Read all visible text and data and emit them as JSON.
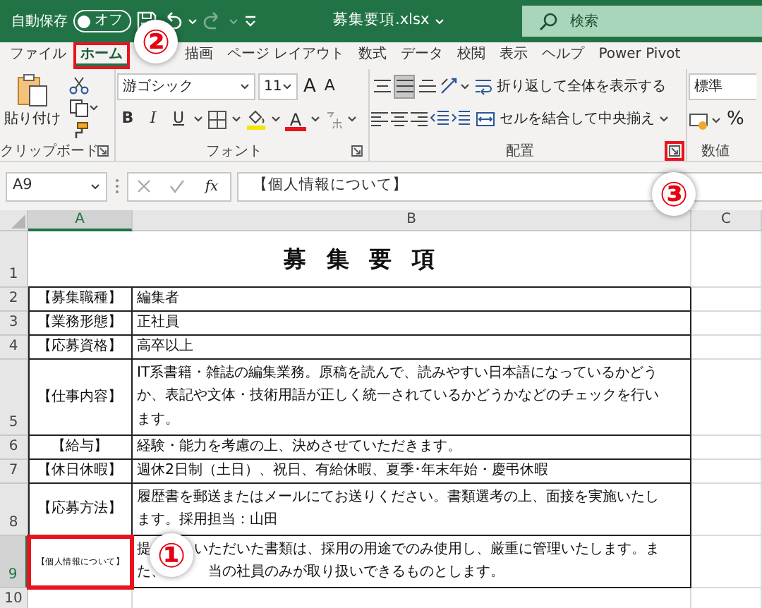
{
  "title_bar": {
    "autosave_label": "自動保存",
    "autosave": {
      "on": false,
      "label": "オフ"
    },
    "file_name": "募集要項.xlsx",
    "search_placeholder": "検索"
  },
  "tabs": [
    {
      "label": "ファイル",
      "selected": false,
      "highlighted": false
    },
    {
      "label": "ホーム",
      "selected": true,
      "highlighted": true
    },
    {
      "label": "描画",
      "selected": false,
      "highlighted": false
    },
    {
      "label": "ページ レイアウト",
      "selected": false,
      "highlighted": false
    },
    {
      "label": "数式",
      "selected": false,
      "highlighted": false
    },
    {
      "label": "データ",
      "selected": false,
      "highlighted": false
    },
    {
      "label": "校閲",
      "selected": false,
      "highlighted": false
    },
    {
      "label": "表示",
      "selected": false,
      "highlighted": false
    },
    {
      "label": "ヘルプ",
      "selected": false,
      "highlighted": false
    },
    {
      "label": "Power Pivot",
      "selected": false,
      "highlighted": false
    }
  ],
  "ribbon": {
    "clipboard": {
      "label": "クリップボード",
      "paste_label": "貼り付け",
      "launcher_highlighted": false
    },
    "font": {
      "label": "フォント",
      "font_name": "游ゴシック",
      "font_size": "11",
      "grow": "A",
      "shrink": "A",
      "bold": "B",
      "italic": "I",
      "underline": "U",
      "font_color": "A",
      "launcher_highlighted": false
    },
    "alignment": {
      "label": "配置",
      "launcher_highlighted": true,
      "vertical": [
        {
          "kind": "top",
          "selected": false
        },
        {
          "kind": "middle",
          "selected": true
        },
        {
          "kind": "bottom",
          "selected": false
        }
      ],
      "wrap_text": "折り返して全体を表示する",
      "merge_center": "セルを結合して中央揃え"
    },
    "number": {
      "label": "数値",
      "format": "標準",
      "percent": "%"
    }
  },
  "formula_bar": {
    "name_box": "A9",
    "function_label": "fx",
    "content": "【個人情報について】"
  },
  "sheet": {
    "columns": [
      {
        "label": "A",
        "selected": true
      },
      {
        "label": "B",
        "selected": false
      },
      {
        "label": "C",
        "selected": false
      }
    ],
    "rows": [
      {
        "number": "1",
        "kind": "title",
        "selected": false,
        "title": "募集要項"
      },
      {
        "number": "2",
        "kind": "item",
        "selected": false,
        "label": "【募集職種】",
        "lines": [
          [
            "編集者"
          ]
        ]
      },
      {
        "number": "3",
        "kind": "item",
        "selected": false,
        "label": "【業務形態】",
        "lines": [
          [
            "正社員"
          ]
        ]
      },
      {
        "number": "4",
        "kind": "item",
        "selected": false,
        "label": "【応募資格】",
        "lines": [
          [
            "高卒以上"
          ]
        ]
      },
      {
        "number": "5",
        "kind": "item",
        "selected": false,
        "label": "【仕事内容】",
        "lines": [
          [
            "IT系書籍・雑誌の編集業務。原稿を読んで、読みやすい日本語になっているかどう"
          ],
          [
            "か、表記や文体・技術用語が正しく統一されているかどうかなどのチェックを行い"
          ],
          [
            "ます。"
          ]
        ]
      },
      {
        "number": "6",
        "kind": "item",
        "selected": false,
        "label": "【給与】",
        "lines": [
          [
            "経験・能力を考慮の上、決めさせていただきます。"
          ]
        ]
      },
      {
        "number": "7",
        "kind": "item",
        "selected": false,
        "label": "【休日休暇】",
        "lines": [
          [
            "週休2日制（土日）、祝日、有給休暇、夏季･年末年始・慶弔休暇"
          ]
        ]
      },
      {
        "number": "8",
        "kind": "item",
        "selected": false,
        "label": "【応募方法】",
        "lines": [
          [
            "履歴書を郵送またはメールにてお送りください。書類選考の上、面接を実施いたし"
          ],
          [
            "ます。採用担当：山田"
          ]
        ]
      },
      {
        "number": "9",
        "kind": "item",
        "selected": true,
        "highlighted": true,
        "shrink_to_fit": true,
        "label": "【個人情報について】",
        "lines": [
          [
            "提",
            "いただいた書類は、採用の用途でのみ使用し、厳重に管理いたします。ま"
          ],
          [
            "た、",
            "当の社員のみが取り扱いできるものとします。"
          ]
        ]
      },
      {
        "number": "10",
        "kind": "empty",
        "selected": false
      }
    ]
  },
  "annotations": [
    {
      "label": "②"
    },
    {
      "label": "③"
    },
    {
      "label": "①"
    }
  ]
}
